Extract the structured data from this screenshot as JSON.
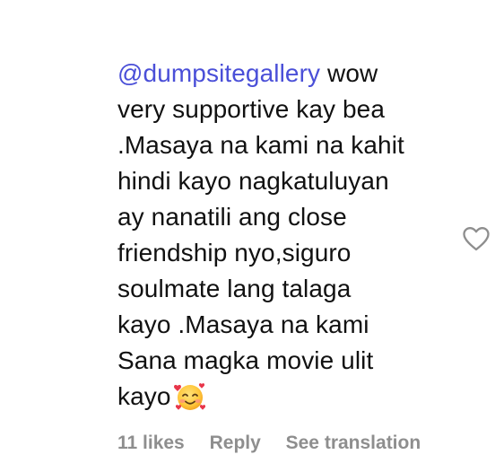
{
  "comment": {
    "mention": "@dumpsitegallery",
    "lines": [
      " wow",
      "very supportive kay bea",
      ".Masaya na kami na kahit",
      "hindi kayo nagkatuluyan",
      "ay nanatili ang close",
      "friendship nyo,siguro",
      "soulmate lang talaga",
      "kayo .Masaya na kami",
      "Sana magka movie ulit",
      "kayo"
    ],
    "emoji_icon": "smiling-face-with-hearts-icon"
  },
  "actions": {
    "likes": "11 likes",
    "reply": "Reply",
    "translate": "See translation",
    "like_icon": "heart-outline-icon"
  },
  "colors": {
    "mention": "#4a4fd8",
    "text": "#111111",
    "meta": "#8e8e8e",
    "heart_outline": "#8e8e8e"
  }
}
